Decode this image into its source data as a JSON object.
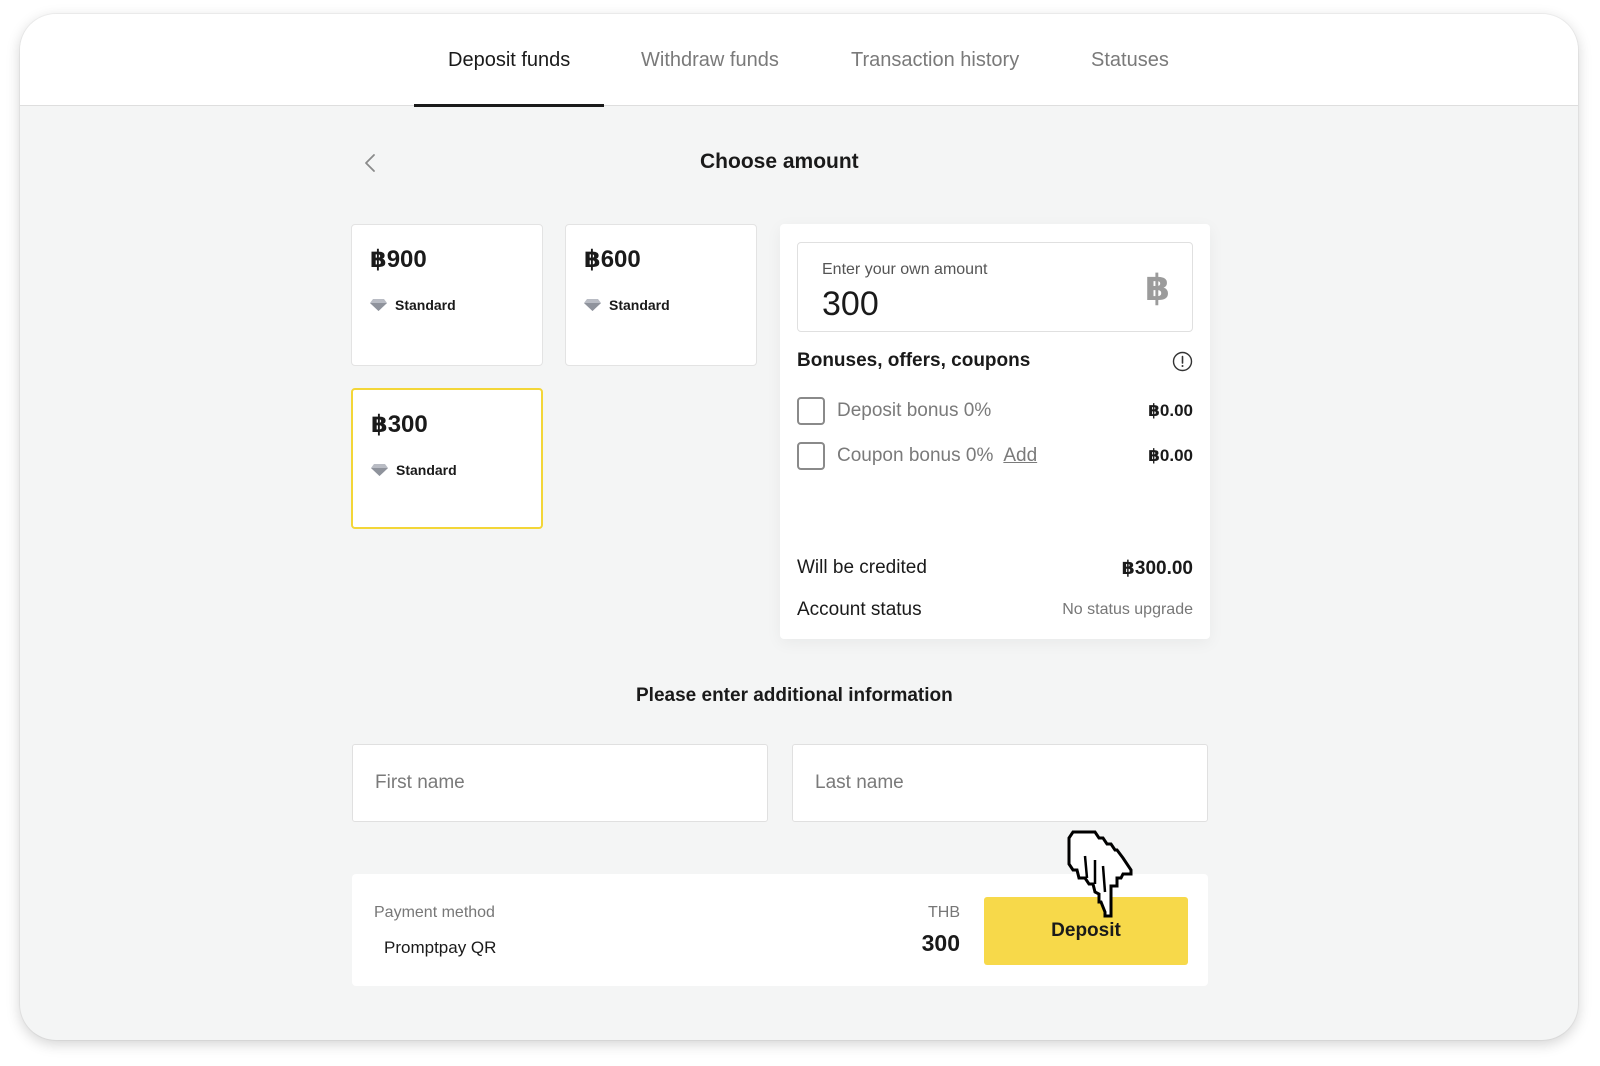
{
  "tabs": [
    {
      "label": "Deposit funds",
      "active": true
    },
    {
      "label": "Withdraw funds",
      "active": false
    },
    {
      "label": "Transaction history",
      "active": false
    },
    {
      "label": "Statuses",
      "active": false
    }
  ],
  "header": {
    "title": "Choose amount",
    "back_icon": "chevron-left-icon"
  },
  "amounts": [
    {
      "value": "฿900",
      "tier": "Standard",
      "selected": false
    },
    {
      "value": "฿600",
      "tier": "Standard",
      "selected": false
    },
    {
      "value": "฿300",
      "tier": "Standard",
      "selected": true
    }
  ],
  "panel": {
    "own_amount_label": "Enter your own amount",
    "own_amount_value": "300",
    "currency_symbol": "฿",
    "bonus_title": "Bonuses, offers, coupons",
    "deposit_bonus_label": "Deposit bonus 0%",
    "deposit_bonus_amount": "฿0.00",
    "coupon_bonus_label": "Coupon bonus 0%",
    "coupon_add_label": "Add",
    "coupon_bonus_amount": "฿0.00",
    "credited_label": "Will be credited",
    "credited_value": "฿300.00",
    "status_label": "Account status",
    "status_value": "No status upgrade"
  },
  "info": {
    "title": "Please enter additional information",
    "first_name_placeholder": "First name",
    "last_name_placeholder": "Last name"
  },
  "payment": {
    "method_label": "Payment method",
    "method_value": "Promptpay QR",
    "currency": "THB",
    "amount": "300",
    "deposit_label": "Deposit"
  },
  "colors": {
    "accent_yellow": "#f7d94a",
    "selected_border": "#f3d638"
  }
}
